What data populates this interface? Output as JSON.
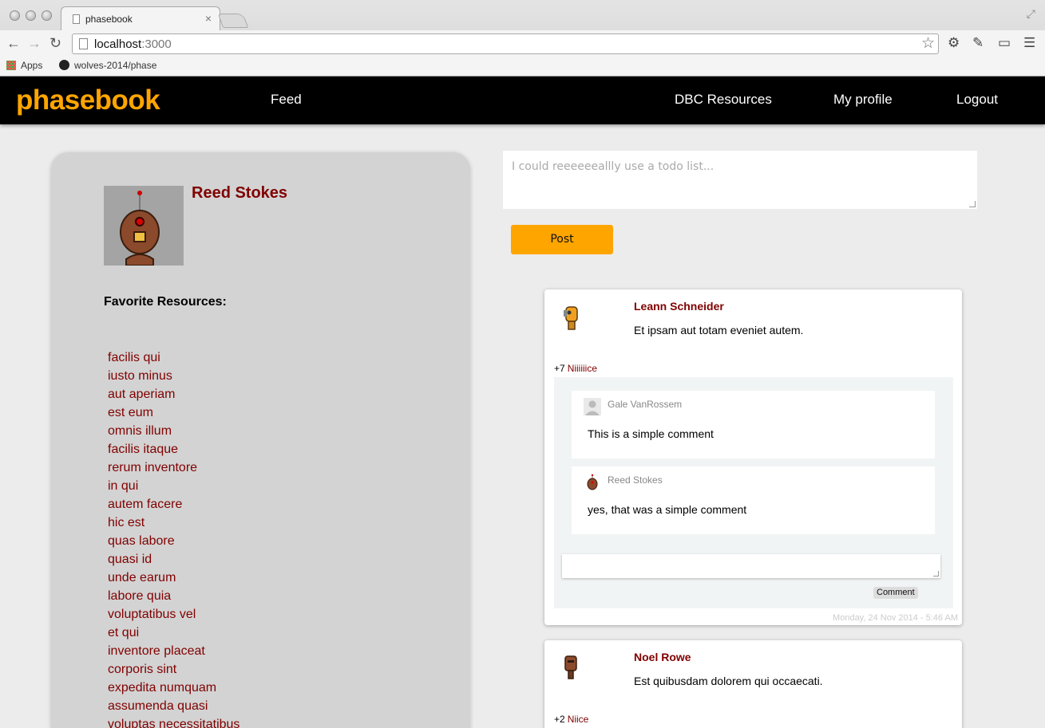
{
  "browser": {
    "tab_title": "phasebook",
    "url_host": "localhost",
    "url_port": ":3000",
    "bookmarks": [
      "Apps",
      "wolves-2014/phase"
    ]
  },
  "navbar": {
    "brand": "phasebook",
    "links": [
      "Feed",
      "DBC Resources",
      "My profile",
      "Logout"
    ]
  },
  "profile": {
    "name": "Reed Stokes",
    "favorites_heading": "Favorite Resources:",
    "favorites": [
      "facilis qui",
      "iusto minus",
      "aut aperiam",
      "est eum",
      "omnis illum",
      "facilis itaque",
      "rerum inventore",
      "in qui",
      "autem facere",
      "hic est",
      "quas labore",
      "quasi id",
      "unde earum",
      "labore quia",
      "voluptatibus vel",
      "et qui",
      "inventore placeat",
      "corporis sint",
      "expedita numquam",
      "assumenda quasi",
      "voluptas necessitatibus"
    ]
  },
  "composer": {
    "placeholder": "I could reeeeeeallly use a todo list...",
    "post_label": "Post"
  },
  "feed": [
    {
      "author": "Leann Schneider",
      "text": "Et ipsam aut totam eveniet autem.",
      "votes": "+7",
      "vote_label": "Niiiiiice",
      "comments": [
        {
          "author": "Gale VanRossem",
          "text": "This is a simple comment"
        },
        {
          "author": "Reed Stokes",
          "text": "yes, that was a simple comment"
        }
      ],
      "comment_button": "Comment",
      "timestamp": "Monday, 24 Nov 2014 - 5:46 AM"
    },
    {
      "author": "Noel Rowe",
      "text": "Est quibusdam dolorem qui occaecati.",
      "votes": "+2",
      "vote_label": "Niice"
    }
  ],
  "colors": {
    "brand": "#ffa500",
    "author_link": "#800000",
    "navbar_bg": "#000000",
    "sidebar_bg": "#d3d3d3"
  }
}
